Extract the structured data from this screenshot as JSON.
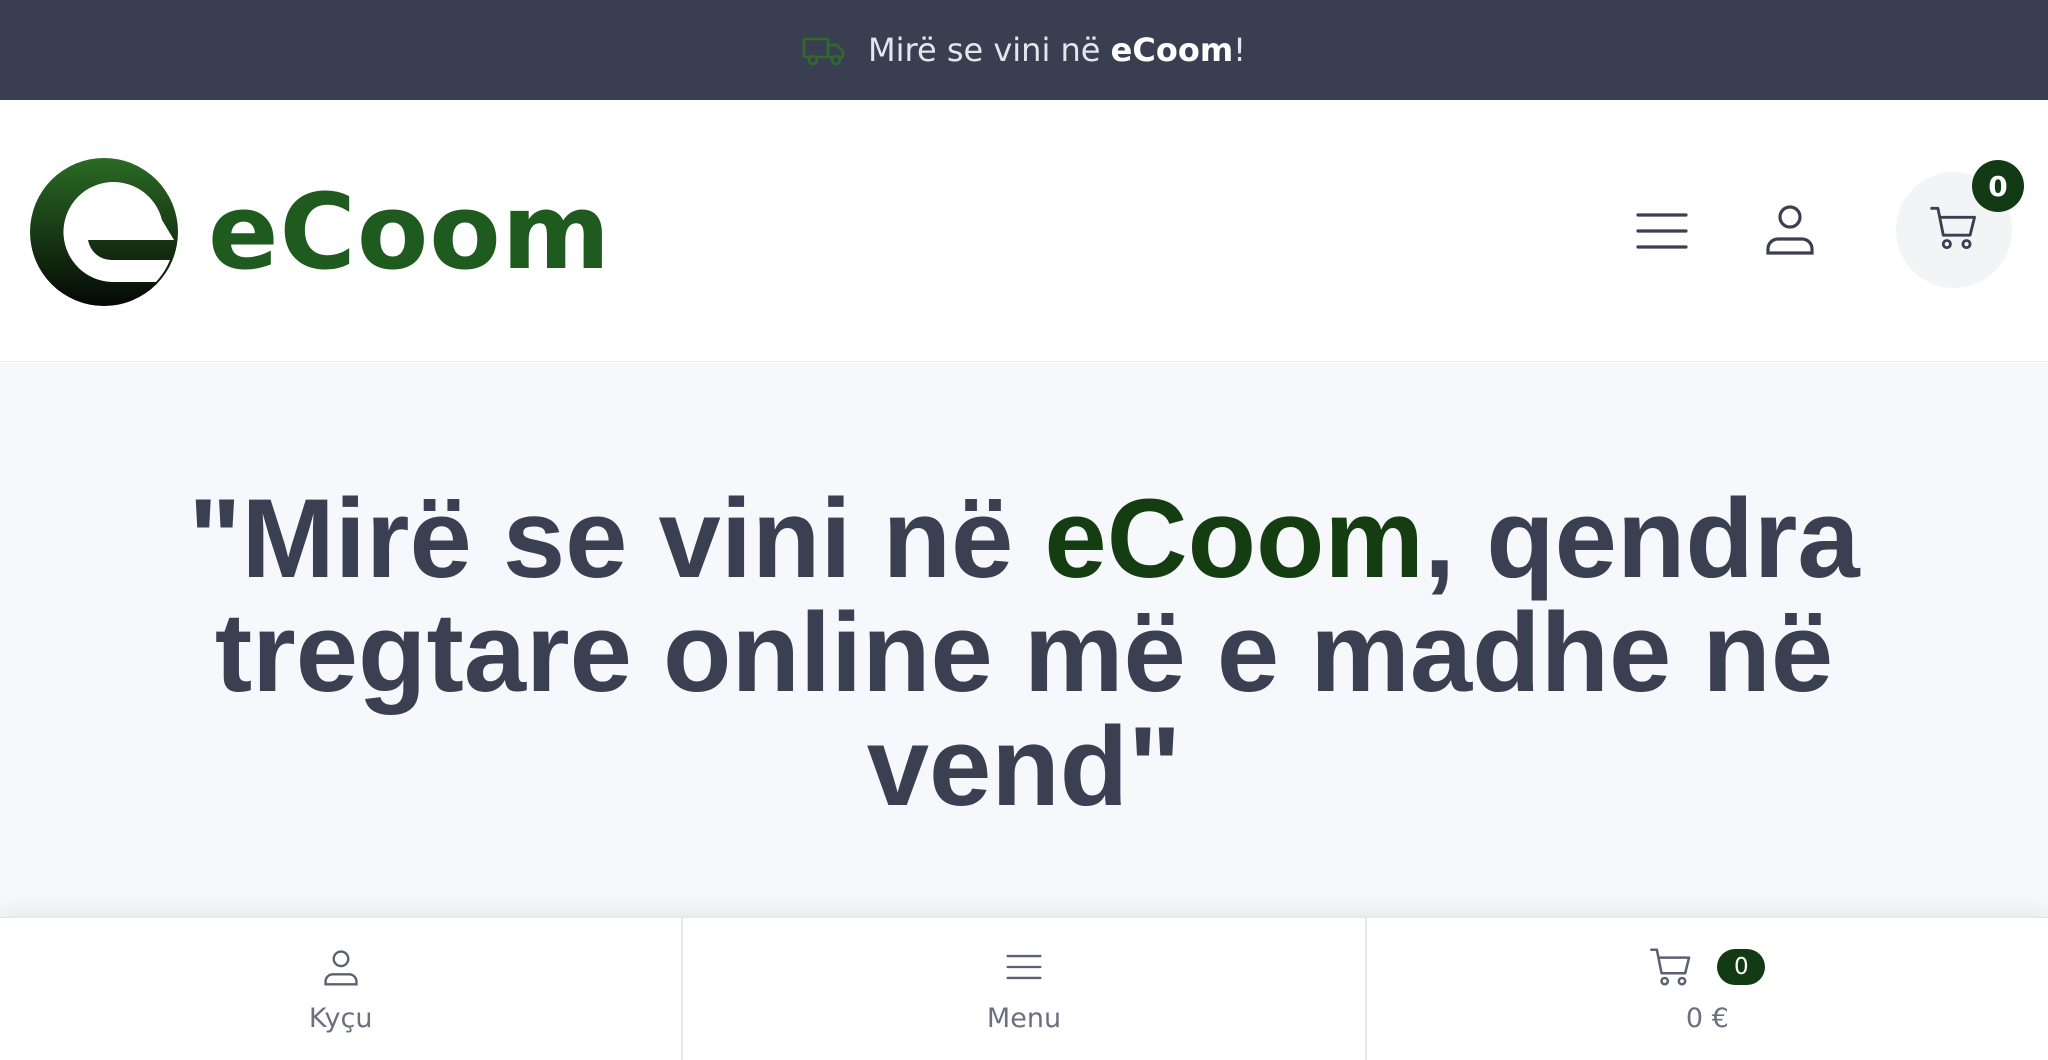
{
  "topbar": {
    "welcome_prefix": "Mirë se vini në ",
    "welcome_brand": "eCoom",
    "welcome_suffix": "!",
    "icon": "truck-icon"
  },
  "header": {
    "logo_text": "eCoom",
    "icons": [
      "menu-icon",
      "user-icon",
      "cart-icon"
    ],
    "cart_count": "0"
  },
  "hero": {
    "quote_open": "\"Mirë se vini në ",
    "brand": "eCoom",
    "quote_rest": ", qendra tregtare online më e madhe në vend\""
  },
  "bottom_nav": {
    "login_label": "Kyçu",
    "menu_label": "Menu",
    "cart_total": "0 €",
    "cart_count": "0"
  },
  "colors": {
    "topbar_bg": "#393f50",
    "brand_green": "#1f5a1e",
    "hero_text": "#3a3f52",
    "badge_bg": "#123a14"
  }
}
